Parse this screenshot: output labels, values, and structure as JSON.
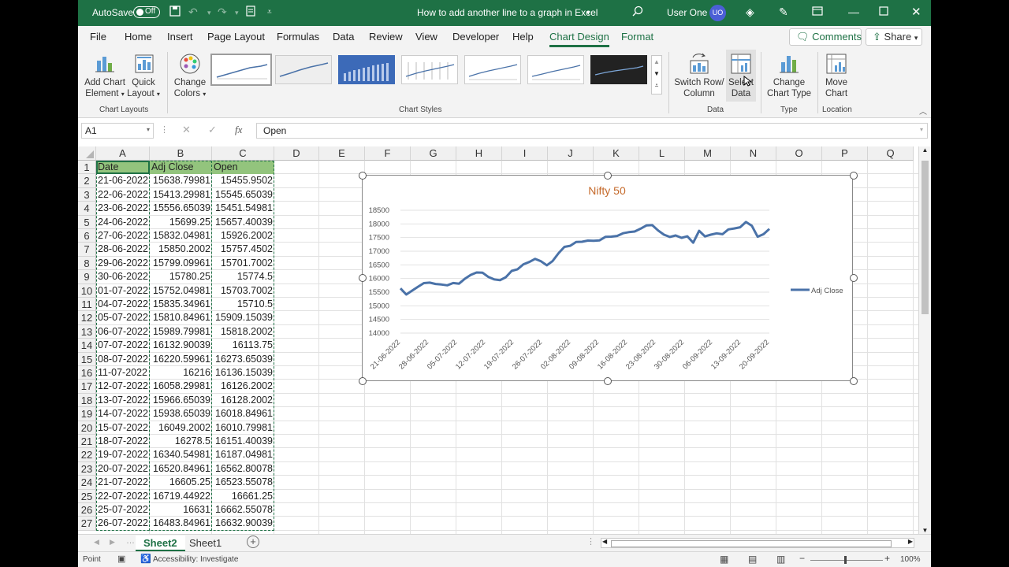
{
  "titlebar": {
    "autosave_label": "AutoSave",
    "autosave_state": "Off",
    "document_title": "How to add another line to a graph in Excel",
    "user_name": "User One",
    "user_initials": "UO"
  },
  "menu": {
    "tabs": [
      "File",
      "Home",
      "Insert",
      "Page Layout",
      "Formulas",
      "Data",
      "Review",
      "View",
      "Developer",
      "Help",
      "Chart Design",
      "Format"
    ],
    "active_tab": "Chart Design",
    "comments_label": "Comments",
    "share_label": "Share"
  },
  "ribbon": {
    "add_chart_element": [
      "Add Chart",
      "Element"
    ],
    "quick_layout": [
      "Quick",
      "Layout"
    ],
    "change_colors": [
      "Change",
      "Colors"
    ],
    "chart_layouts_group": "Chart Layouts",
    "chart_styles_group": "Chart Styles",
    "switch_row_column": [
      "Switch Row/",
      "Column"
    ],
    "select_data": [
      "Select",
      "Data"
    ],
    "data_group": "Data",
    "change_chart_type": [
      "Change",
      "Chart Type"
    ],
    "type_group": "Type",
    "move_chart": [
      "Move",
      "Chart"
    ],
    "location_group": "Location"
  },
  "formula_bar": {
    "name_box": "A1",
    "fx_label": "fx",
    "content": "Open"
  },
  "sheet": {
    "columns": [
      "A",
      "B",
      "C",
      "D",
      "E",
      "F",
      "G",
      "H",
      "I",
      "J",
      "K",
      "L",
      "M",
      "N",
      "O",
      "P",
      "Q"
    ],
    "rows": [
      "1",
      "2",
      "3",
      "4",
      "5",
      "6",
      "7",
      "8",
      "9",
      "10",
      "11",
      "12",
      "13",
      "14",
      "15",
      "16",
      "17",
      "18",
      "19",
      "20",
      "21",
      "22",
      "23",
      "24",
      "25",
      "26",
      "27"
    ],
    "header": [
      "Date",
      "Adj Close",
      "Open"
    ],
    "data": [
      [
        "21-06-2022",
        "15638.79981",
        "15455.9502"
      ],
      [
        "22-06-2022",
        "15413.29981",
        "15545.65039"
      ],
      [
        "23-06-2022",
        "15556.65039",
        "15451.54981"
      ],
      [
        "24-06-2022",
        "15699.25",
        "15657.40039"
      ],
      [
        "27-06-2022",
        "15832.04981",
        "15926.2002"
      ],
      [
        "28-06-2022",
        "15850.2002",
        "15757.4502"
      ],
      [
        "29-06-2022",
        "15799.09961",
        "15701.7002"
      ],
      [
        "30-06-2022",
        "15780.25",
        "15774.5"
      ],
      [
        "01-07-2022",
        "15752.04981",
        "15703.7002"
      ],
      [
        "04-07-2022",
        "15835.34961",
        "15710.5"
      ],
      [
        "05-07-2022",
        "15810.84961",
        "15909.15039"
      ],
      [
        "06-07-2022",
        "15989.79981",
        "15818.2002"
      ],
      [
        "07-07-2022",
        "16132.90039",
        "16113.75"
      ],
      [
        "08-07-2022",
        "16220.59961",
        "16273.65039"
      ],
      [
        "11-07-2022",
        "16216",
        "16136.15039"
      ],
      [
        "12-07-2022",
        "16058.29981",
        "16126.2002"
      ],
      [
        "13-07-2022",
        "15966.65039",
        "16128.2002"
      ],
      [
        "14-07-2022",
        "15938.65039",
        "16018.84961"
      ],
      [
        "15-07-2022",
        "16049.2002",
        "16010.79981"
      ],
      [
        "18-07-2022",
        "16278.5",
        "16151.40039"
      ],
      [
        "19-07-2022",
        "16340.54981",
        "16187.04981"
      ],
      [
        "20-07-2022",
        "16520.84961",
        "16562.80078"
      ],
      [
        "21-07-2022",
        "16605.25",
        "16523.55078"
      ],
      [
        "22-07-2022",
        "16719.44922",
        "16661.25"
      ],
      [
        "25-07-2022",
        "16631",
        "16662.55078"
      ],
      [
        "26-07-2022",
        "16483.84961",
        "16632.90039"
      ]
    ]
  },
  "chart_data": {
    "type": "line",
    "title": "Nifty 50",
    "xlabel": "",
    "ylabel": "",
    "ylim": [
      14000,
      18500
    ],
    "yticks": [
      14000,
      14500,
      15000,
      15500,
      16000,
      16500,
      17000,
      17500,
      18000,
      18500
    ],
    "xtick_labels": [
      "21-06-2022",
      "28-06-2022",
      "05-07-2022",
      "12-07-2022",
      "19-07-2022",
      "26-07-2022",
      "02-08-2022",
      "09-08-2022",
      "16-08-2022",
      "23-08-2022",
      "30-08-2022",
      "06-09-2022",
      "13-09-2022",
      "20-09-2022"
    ],
    "legend": "right",
    "grid": true,
    "series": [
      {
        "name": "Adj Close",
        "color": "#4a72a8",
        "values": [
          15638.8,
          15413.3,
          15556.65,
          15699.25,
          15832.05,
          15850.2,
          15799.1,
          15780.25,
          15752.05,
          15835.35,
          15810.85,
          15989.8,
          16132.9,
          16220.6,
          16216,
          16058.3,
          15966.65,
          15938.65,
          16049.2,
          16278.5,
          16340.55,
          16520.85,
          16605.25,
          16719.45,
          16631,
          16483.85,
          16641,
          16929,
          17158,
          17200,
          17340,
          17345,
          17388,
          17382,
          17397,
          17525,
          17535,
          17560,
          17659,
          17698,
          17720,
          17825,
          17944,
          17956,
          17758,
          17605,
          17522,
          17577,
          17490,
          17545,
          17312,
          17748,
          17542,
          17605,
          17655,
          17624,
          17798,
          17833,
          17877,
          18070,
          17936,
          17530,
          17622,
          17816
        ]
      }
    ]
  },
  "sheet_tabs": [
    "Sheet2",
    "Sheet1"
  ],
  "active_sheet": "Sheet2",
  "status": {
    "mode": "Point",
    "accessibility": "Accessibility: Investigate",
    "zoom": "100%"
  }
}
